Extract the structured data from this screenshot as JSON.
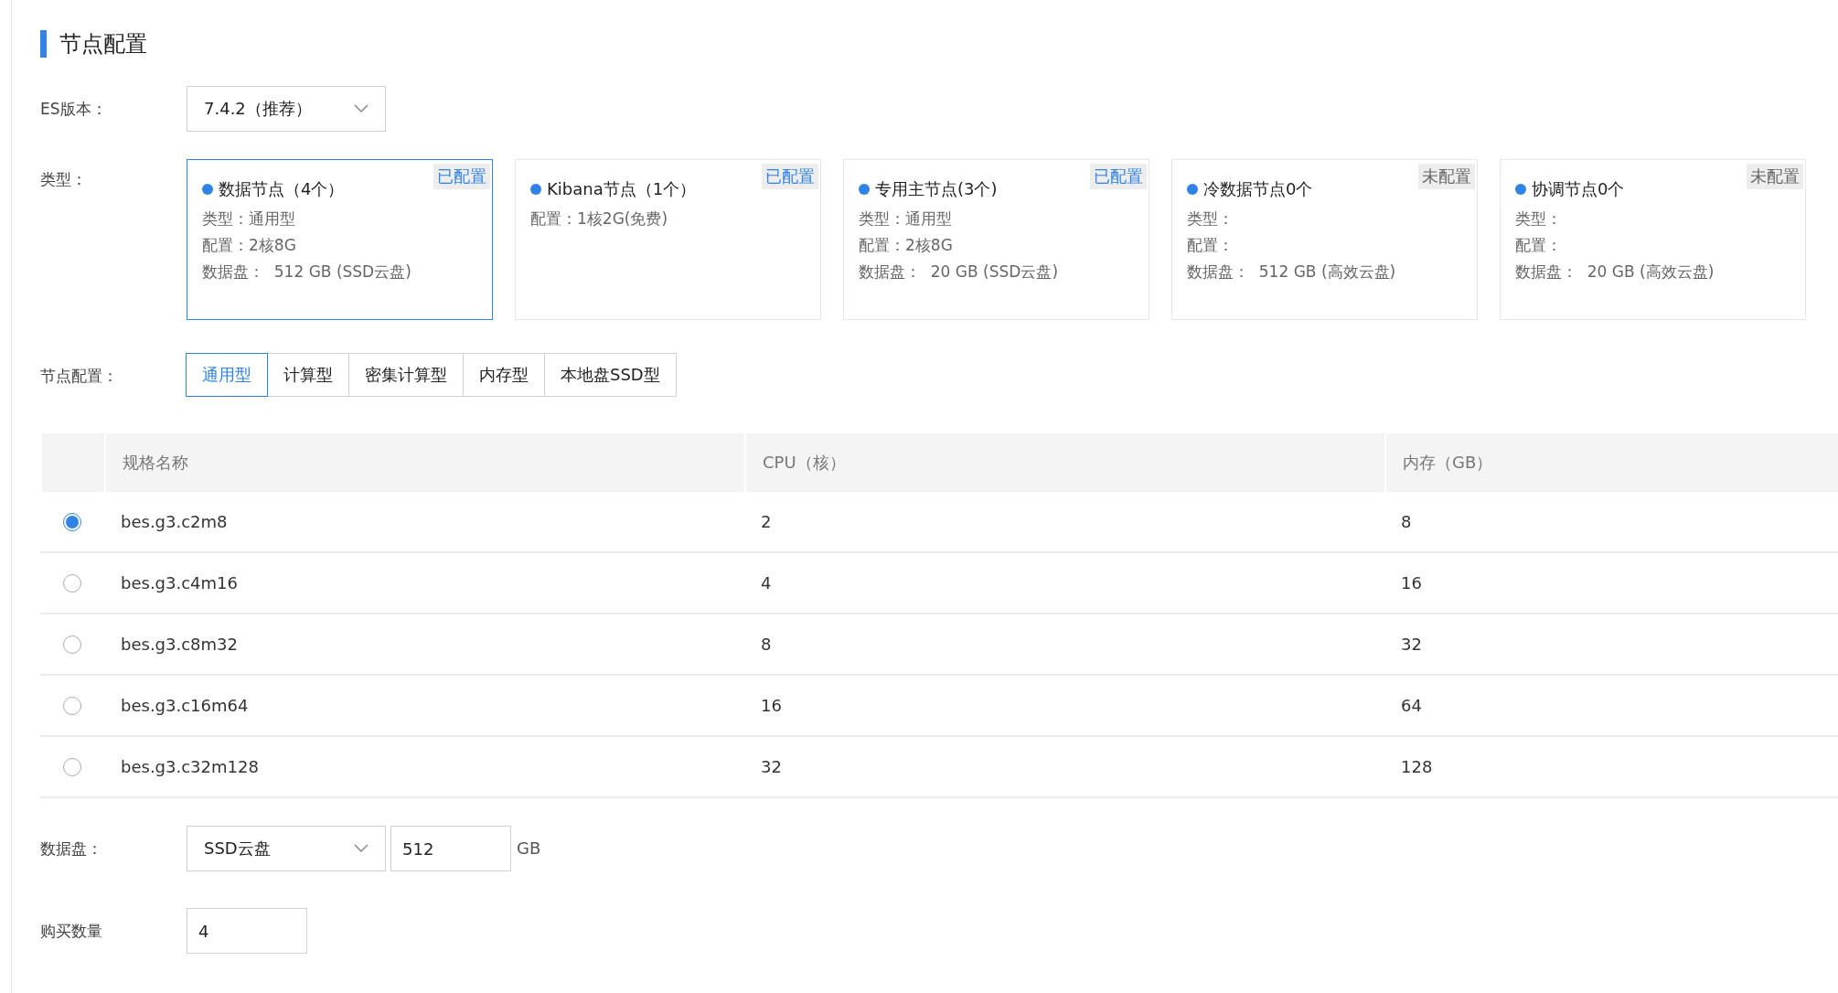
{
  "section_title": "节点配置",
  "version": {
    "label": "ES版本：",
    "value": "7.4.2（推荐）"
  },
  "types": {
    "label": "类型：",
    "cards": [
      {
        "title": "数据节点（4个）",
        "status": "已配置",
        "configured": true,
        "selected": true,
        "lines": [
          "类型：通用型",
          "配置：2核8G",
          "数据盘：  512 GB (SSD云盘)"
        ]
      },
      {
        "title": "Kibana节点（1个）",
        "status": "已配置",
        "configured": true,
        "selected": false,
        "lines": [
          "配置：1核2G(免费)"
        ]
      },
      {
        "title": "专用主节点(3个)",
        "status": "已配置",
        "configured": true,
        "selected": false,
        "lines": [
          "类型：通用型",
          "配置：2核8G",
          "数据盘：  20 GB (SSD云盘)"
        ]
      },
      {
        "title": "冷数据节点0个",
        "status": "未配置",
        "configured": false,
        "selected": false,
        "lines": [
          "类型：",
          "配置：",
          "数据盘：  512 GB (高效云盘)"
        ]
      },
      {
        "title": "协调节点0个",
        "status": "未配置",
        "configured": false,
        "selected": false,
        "lines": [
          "类型：",
          "配置：",
          "数据盘：  20 GB (高效云盘)"
        ]
      }
    ]
  },
  "node_config": {
    "label": "节点配置：",
    "tabs": [
      {
        "label": "通用型",
        "selected": true
      },
      {
        "label": "计算型",
        "selected": false
      },
      {
        "label": "密集计算型",
        "selected": false
      },
      {
        "label": "内存型",
        "selected": false
      },
      {
        "label": "本地盘SSD型",
        "selected": false
      }
    ]
  },
  "table": {
    "columns": [
      "规格名称",
      "CPU（核）",
      "内存（GB）"
    ],
    "rows": [
      {
        "selected": true,
        "cells": [
          "bes.g3.c2m8",
          "2",
          "8"
        ]
      },
      {
        "selected": false,
        "cells": [
          "bes.g3.c4m16",
          "4",
          "16"
        ]
      },
      {
        "selected": false,
        "cells": [
          "bes.g3.c8m32",
          "8",
          "32"
        ]
      },
      {
        "selected": false,
        "cells": [
          "bes.g3.c16m64",
          "16",
          "64"
        ]
      },
      {
        "selected": false,
        "cells": [
          "bes.g3.c32m128",
          "32",
          "128"
        ]
      }
    ]
  },
  "data_disk": {
    "label": "数据盘：",
    "type": "SSD云盘",
    "size": "512",
    "unit": "GB"
  },
  "quantity": {
    "label": "购买数量",
    "value": "4"
  }
}
